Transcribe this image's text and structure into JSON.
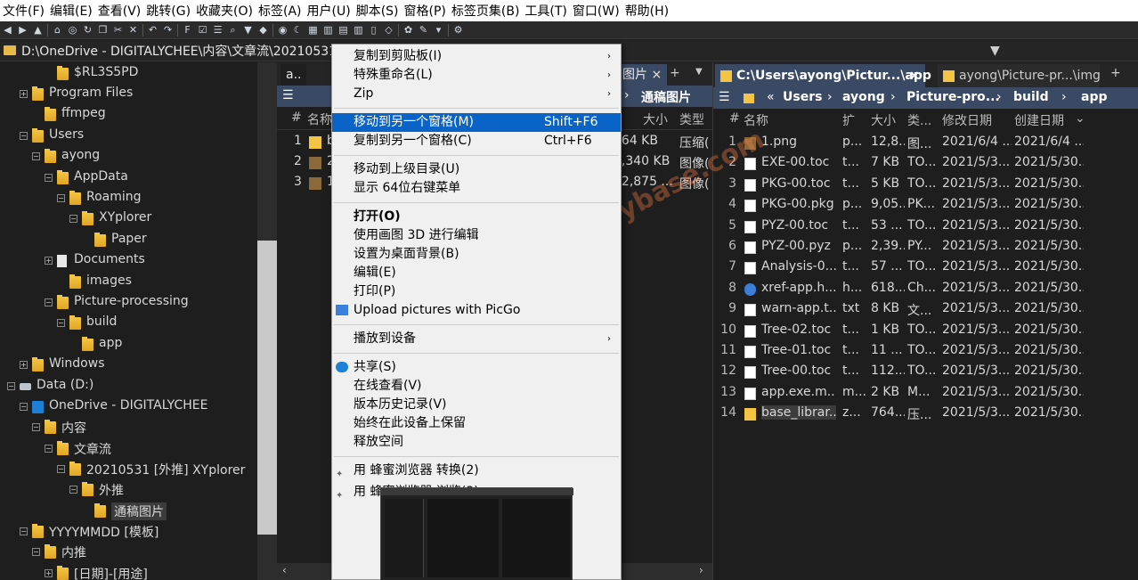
{
  "menubar": {
    "items": [
      "文件(F)",
      "编辑(E)",
      "查看(V)",
      "跳转(G)",
      "收藏夹(O)",
      "标签(A)",
      "用户(U)",
      "脚本(S)",
      "窗格(P)",
      "标签页集(B)",
      "工具(T)",
      "窗口(W)",
      "帮助(H)"
    ]
  },
  "address": {
    "path": "D:\\OneDrive - DIGITALYCHEE\\内容\\文章流\\20210531 [外"
  },
  "tree": {
    "items": [
      "$RL3S5PD",
      "Program Files",
      "ffmpeg",
      "Users",
      "ayong",
      "AppData",
      "Roaming",
      "XYplorer",
      "Paper",
      "Documents",
      "images",
      "Picture-processing",
      "build",
      "app",
      "Windows",
      "Data (D:)",
      "OneDrive - DIGITALYCHEE",
      "内容",
      "文章流",
      "20210531 [外推] XYplorer",
      "外推",
      "通稿图片",
      "YYYYMMDD [模板]",
      "内推",
      "[日期]-[用途]"
    ]
  },
  "midpane": {
    "tab_short": "a..",
    "tab_active": "图片",
    "breadcrumb": "通稿图片",
    "col_name": "名称",
    "col_size": "大小",
    "col_type": "类型",
    "rows": [
      {
        "num": "1",
        "name": "b",
        "size": "764 KB",
        "type": "压缩("
      },
      {
        "num": "2",
        "name": "2",
        "size": "2,340 KB",
        "type": "图像("
      },
      {
        "num": "3",
        "name": "1",
        "size": "12,875 ...",
        "type": "图像("
      }
    ]
  },
  "rightpane": {
    "tab_active": "C:\\Users\\ayong\\Pictur...\\app",
    "tab_inactive": "ayong\\Picture-pr...\\img",
    "breadcrumb": [
      "Users",
      "ayong",
      "Picture-pro...",
      "build",
      "app"
    ],
    "columns": {
      "num": "#",
      "name": "名称",
      "ext": "扩",
      "size": "大小",
      "type": "类...",
      "modified": "修改日期",
      "created": "创建日期"
    },
    "rows": [
      {
        "num": "1",
        "name": "1.png",
        "ext": "p...",
        "size": "12,8...",
        "type": "图...",
        "modified": "2021/6/4 ...",
        "created": "2021/6/4 ..."
      },
      {
        "num": "2",
        "name": "EXE-00.toc",
        "ext": "t...",
        "size": "7 KB",
        "type": "TO...",
        "modified": "2021/5/3...",
        "created": "2021/5/30..."
      },
      {
        "num": "3",
        "name": "PKG-00.toc",
        "ext": "t...",
        "size": "5 KB",
        "type": "TO...",
        "modified": "2021/5/3...",
        "created": "2021/5/30..."
      },
      {
        "num": "4",
        "name": "PKG-00.pkg",
        "ext": "p...",
        "size": "9,05...",
        "type": "PK...",
        "modified": "2021/5/3...",
        "created": "2021/5/30..."
      },
      {
        "num": "5",
        "name": "PYZ-00.toc",
        "ext": "t...",
        "size": "53 ...",
        "type": "TO...",
        "modified": "2021/5/3...",
        "created": "2021/5/30..."
      },
      {
        "num": "6",
        "name": "PYZ-00.pyz",
        "ext": "p...",
        "size": "2,39...",
        "type": "PY...",
        "modified": "2021/5/3...",
        "created": "2021/5/30..."
      },
      {
        "num": "7",
        "name": "Analysis-0...",
        "ext": "t...",
        "size": "57 ...",
        "type": "TO...",
        "modified": "2021/5/3...",
        "created": "2021/5/30..."
      },
      {
        "num": "8",
        "name": "xref-app.h...",
        "ext": "h...",
        "size": "618...",
        "type": "Ch...",
        "modified": "2021/5/3...",
        "created": "2021/5/30..."
      },
      {
        "num": "9",
        "name": "warn-app.t...",
        "ext": "txt",
        "size": "8 KB",
        "type": "文...",
        "modified": "2021/5/3...",
        "created": "2021/5/30..."
      },
      {
        "num": "10",
        "name": "Tree-02.toc",
        "ext": "t...",
        "size": "1 KB",
        "type": "TO...",
        "modified": "2021/5/3...",
        "created": "2021/5/30..."
      },
      {
        "num": "11",
        "name": "Tree-01.toc",
        "ext": "t...",
        "size": "11 ...",
        "type": "TO...",
        "modified": "2021/5/3...",
        "created": "2021/5/30..."
      },
      {
        "num": "12",
        "name": "Tree-00.toc",
        "ext": "t...",
        "size": "112...",
        "type": "TO...",
        "modified": "2021/5/3...",
        "created": "2021/5/30..."
      },
      {
        "num": "13",
        "name": "app.exe.m...",
        "ext": "m...",
        "size": "2 KB",
        "type": "M...",
        "modified": "2021/5/3...",
        "created": "2021/5/30..."
      },
      {
        "num": "14",
        "name": "base_librar...",
        "ext": "z...",
        "size": "764...",
        "type": "压...",
        "modified": "2021/5/3...",
        "created": "2021/5/30..."
      }
    ]
  },
  "contextmenu": {
    "items": [
      {
        "label": "复制到剪贴板(I)",
        "arrow": "›"
      },
      {
        "label": "特殊重命名(L)",
        "arrow": "›"
      },
      {
        "label": "Zip",
        "arrow": "›"
      },
      {
        "label": "移动到另一个窗格(M)",
        "key": "Shift+F6"
      },
      {
        "label": "复制到另一个窗格(C)",
        "key": "Ctrl+F6"
      },
      {
        "label": "移动到上级目录(U)"
      },
      {
        "label": "显示 64位右键菜单"
      },
      {
        "label": "打开(O)"
      },
      {
        "label": "使用画图 3D 进行编辑"
      },
      {
        "label": "设置为桌面背景(B)"
      },
      {
        "label": "编辑(E)"
      },
      {
        "label": "打印(P)"
      },
      {
        "label": "Upload pictures with PicGo"
      },
      {
        "label": "播放到设备",
        "arrow": "›"
      },
      {
        "label": "共享(S)"
      },
      {
        "label": "在线查看(V)"
      },
      {
        "label": "版本历史记录(V)"
      },
      {
        "label": "始终在此设备上保留"
      },
      {
        "label": "释放空间"
      },
      {
        "label": "用 蜂蜜浏览器 转换(2)"
      },
      {
        "label": "用 蜂蜜浏览器 浏览(3)"
      }
    ]
  },
  "watermark": "收藏:黑域基地 Hybase.com",
  "colors": {
    "accent": "#0a64c8",
    "breadcrumb_bg": "#3b4a64",
    "folder": "#f4c542"
  }
}
